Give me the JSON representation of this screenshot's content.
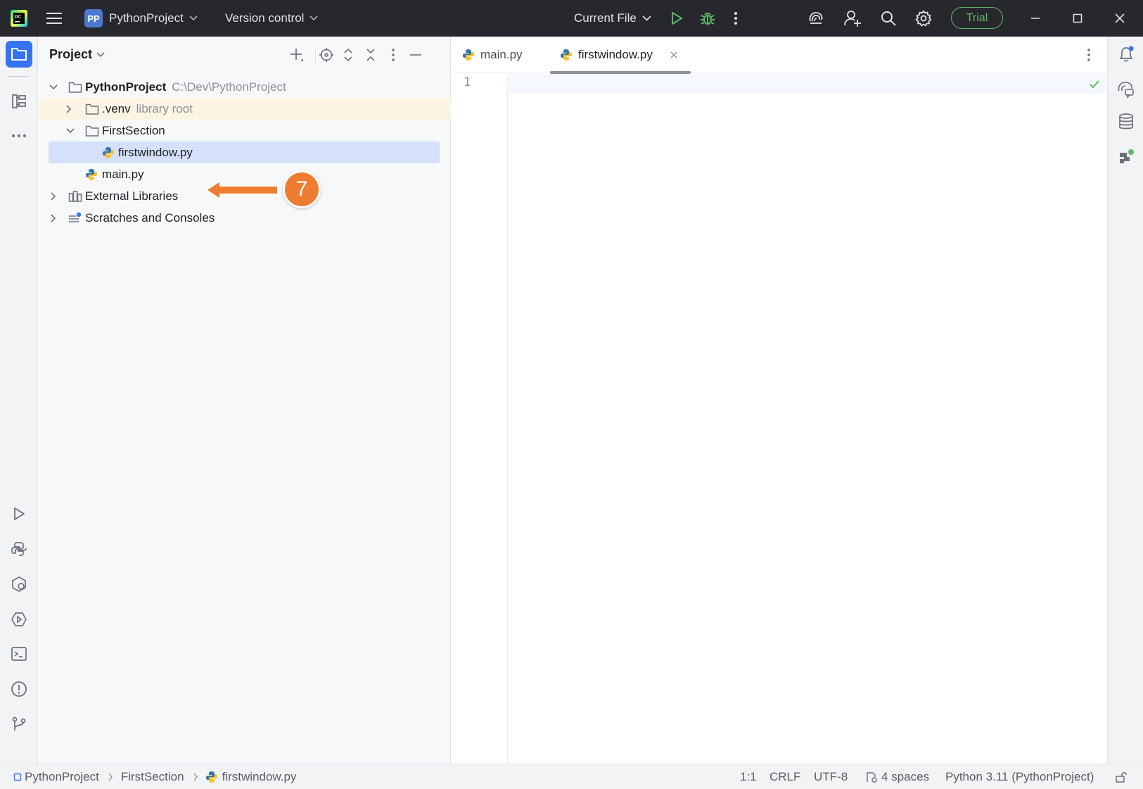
{
  "titlebar": {
    "project_badge": "PP",
    "project_name": "PythonProject",
    "version_control": "Version control",
    "run_config": "Current File",
    "trial_label": "Trial",
    "colors": {
      "background": "#27282e",
      "run": "#5fb865",
      "debug": "#5fb865",
      "trial": "#5fb865"
    }
  },
  "project_panel": {
    "title": "Project",
    "tree": {
      "root": {
        "name": "PythonProject",
        "path": "C:\\Dev\\PythonProject"
      },
      "venv": {
        "name": ".venv",
        "hint": "library root"
      },
      "first_section": "FirstSection",
      "firstwindow": "firstwindow.py",
      "main": "main.py",
      "external_libraries": "External Libraries",
      "scratches": "Scratches and Consoles"
    },
    "callout_number": "7"
  },
  "editor": {
    "tabs": [
      {
        "label": "main.py",
        "active": false
      },
      {
        "label": "firstwindow.py",
        "active": true
      }
    ],
    "line_numbers": [
      "1"
    ]
  },
  "statusbar": {
    "breadcrumb": [
      "PythonProject",
      "FirstSection",
      "firstwindow.py"
    ],
    "position": "1:1",
    "line_ending": "CRLF",
    "encoding": "UTF-8",
    "indent": "4 spaces",
    "interpreter": "Python 3.11 (PythonProject)"
  }
}
